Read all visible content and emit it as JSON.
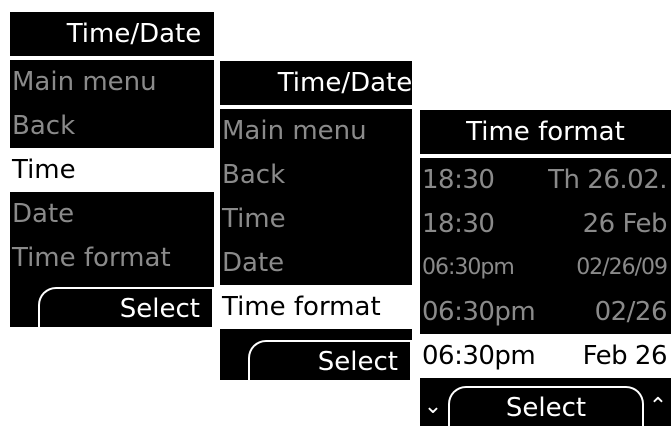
{
  "screens": [
    {
      "title": "Time/Date",
      "items": [
        {
          "label": "Main menu"
        },
        {
          "label": "Back"
        },
        {
          "label": "Time",
          "selected": true
        },
        {
          "label": "Date"
        },
        {
          "label": "Time format"
        }
      ],
      "softkey": "Select"
    },
    {
      "title": "Time/Date",
      "items": [
        {
          "label": "Main menu"
        },
        {
          "label": "Back"
        },
        {
          "label": "Time"
        },
        {
          "label": "Date"
        },
        {
          "label": "Time format",
          "selected": true
        }
      ],
      "softkey": "Select"
    },
    {
      "title": "Time format",
      "items": [
        {
          "time": "18:30",
          "date": "Th 26.02."
        },
        {
          "time": "18:30",
          "date": "26 Feb"
        },
        {
          "time": "06:30pm",
          "date": "02/26/09"
        },
        {
          "time": "06:30pm",
          "date": "02/26"
        },
        {
          "time": "06:30pm",
          "date": "Feb 26",
          "selected": true
        }
      ],
      "softkey": "Select",
      "scroll_down_icon": "chevron-down-icon",
      "scroll_up_icon": "chevron-up-icon"
    }
  ],
  "colors": {
    "background": "#000000",
    "text_selected": "#000000",
    "highlight": "#ffffff",
    "text_normal": "#8a8a8a"
  }
}
